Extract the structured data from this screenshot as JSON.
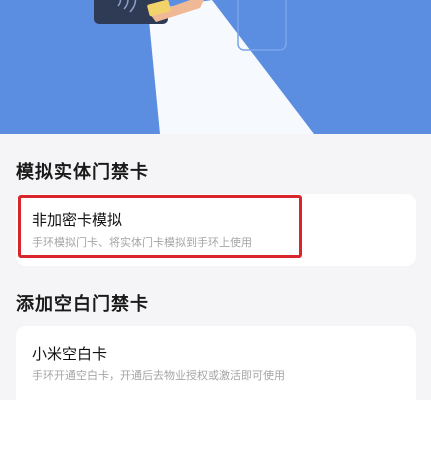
{
  "sections": [
    {
      "title": "模拟实体门禁卡",
      "card": {
        "title": "非加密卡模拟",
        "subtitle": "手环模拟门卡、将实体门卡模拟到手环上使用"
      }
    },
    {
      "title": "添加空白门禁卡",
      "card": {
        "title": "小米空白卡",
        "subtitle": "手环开通空白卡，开通后去物业授权或激活即可使用"
      }
    }
  ],
  "colors": {
    "hero_background": "#5b8ee0",
    "highlight_border": "#d9262c"
  },
  "icons": {
    "hero": "card-reader-illustration"
  }
}
